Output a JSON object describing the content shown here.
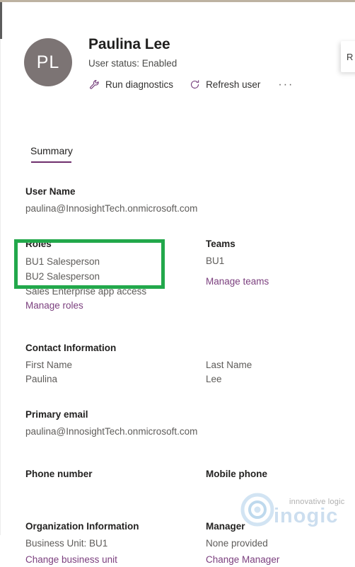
{
  "window": {
    "right_peek_card_label": "R"
  },
  "header": {
    "avatar_initials": "PL",
    "user_name": "Paulina Lee",
    "status_text": "User status: Enabled",
    "commands": [
      {
        "icon": "wrench-icon",
        "label": "Run diagnostics"
      },
      {
        "icon": "refresh-icon",
        "label": "Refresh user"
      }
    ],
    "more_actions_glyph": "···"
  },
  "tabs": [
    {
      "label": "Summary",
      "active": true
    }
  ],
  "summary": {
    "user_name": {
      "label": "User Name",
      "value": "paulina@InnosightTech.onmicrosoft.com"
    },
    "roles": {
      "label": "Roles",
      "items": [
        "BU1 Salesperson",
        "BU2 Salesperson",
        "Sales Enterprise app access"
      ],
      "link": "Manage roles"
    },
    "teams": {
      "label": "Teams",
      "items": [
        "BU1"
      ],
      "link": "Manage teams"
    },
    "contact_information": {
      "label": "Contact Information",
      "first_name_label": "First Name",
      "first_name_value": "Paulina",
      "last_name_label": "Last Name",
      "last_name_value": "Lee"
    },
    "primary_email": {
      "label": "Primary email",
      "value": "paulina@InnosightTech.onmicrosoft.com"
    },
    "phone_number": {
      "label": "Phone number",
      "value": ""
    },
    "mobile_phone": {
      "label": "Mobile phone",
      "value": ""
    },
    "organization_information": {
      "label": "Organization Information",
      "business_unit": "Business Unit: BU1",
      "link": "Change business unit"
    },
    "manager": {
      "label": "Manager",
      "value": "None provided",
      "link": "Change Manager"
    }
  },
  "annotation": {
    "highlight_color": "#22a84b",
    "target": "roles-list"
  },
  "watermark": {
    "tagline": "innovative logic",
    "wordmark": "inogic"
  },
  "colors": {
    "accent_purple": "#7b3f7e",
    "tab_underline": "#6f2f6d",
    "avatar_bg": "#7c7474",
    "annotation_green": "#22a84b",
    "top_strip": "#bdb2a1"
  }
}
